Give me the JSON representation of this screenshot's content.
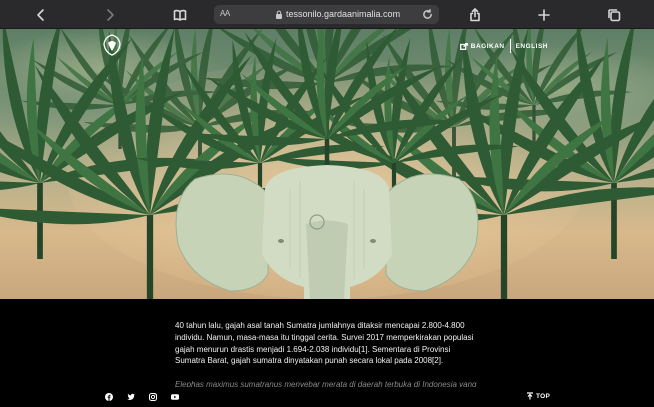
{
  "browser": {
    "text_size_label": "AA",
    "url": "tessonilo.gardaanimalia.com",
    "icons": [
      "back-icon",
      "forward-icon",
      "reader-icon",
      "lock-icon",
      "reload-icon",
      "share-icon",
      "new-tab-icon",
      "tabs-icon"
    ]
  },
  "hero": {
    "share_label": "BAGIKAN",
    "language_label": "ENGLISH",
    "palette": {
      "sky_top": "#5e7f66",
      "sky_bottom": "#d7b98c",
      "palm": "#2f5b34",
      "elephant": "#cfd9c0"
    }
  },
  "article": {
    "paragraph": "40 tahun lalu, gajah asal tanah Sumatra jumlahnya ditaksir mencapai 2.800-4.800 individu. Namun, masa-masa itu tinggal cerita. Survei 2017 memperkirakan populasi gajah menurun drastis menjadi 1.694-2.038 individu[1]. Sementara di Provinsi Sumatra Barat, gajah sumatra dinyatakan punah secara lokal pada 2008[2].",
    "next_paragraph_partial": "Elephas maximus sumatranus menyebar merata di daerah terbuka di Indonesia yang"
  },
  "footer": {
    "social_icons": [
      "facebook-icon",
      "twitter-icon",
      "instagram-icon",
      "youtube-icon"
    ],
    "top_label": "TOP"
  }
}
